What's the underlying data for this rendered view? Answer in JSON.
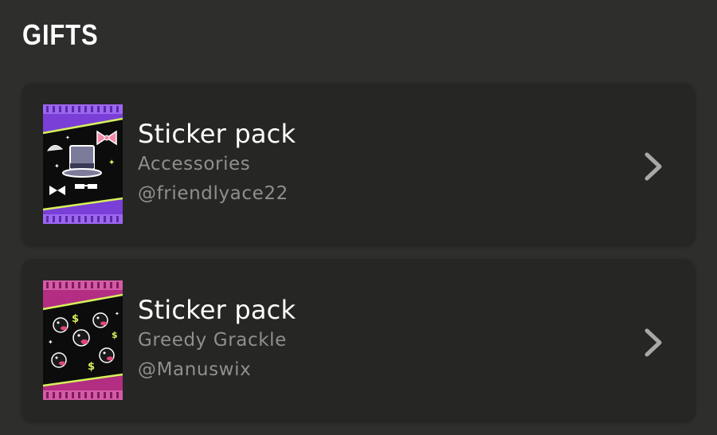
{
  "section": {
    "title": "GIFTS"
  },
  "gifts": [
    {
      "title": "Sticker pack",
      "pack_name": "Accessories",
      "author": "@friendlyace22",
      "theme_color": "#8a4fe0",
      "icon": "sticker-pack-accessories-icon"
    },
    {
      "title": "Sticker pack",
      "pack_name": "Greedy Grackle",
      "author": "@Manuswix",
      "theme_color": "#c2368f",
      "icon": "sticker-pack-greedy-grackle-icon"
    }
  ],
  "colors": {
    "background": "#2e2f2d",
    "card": "#262725",
    "secondary_text": "#8f908d",
    "chevron": "#a8a9a6"
  }
}
